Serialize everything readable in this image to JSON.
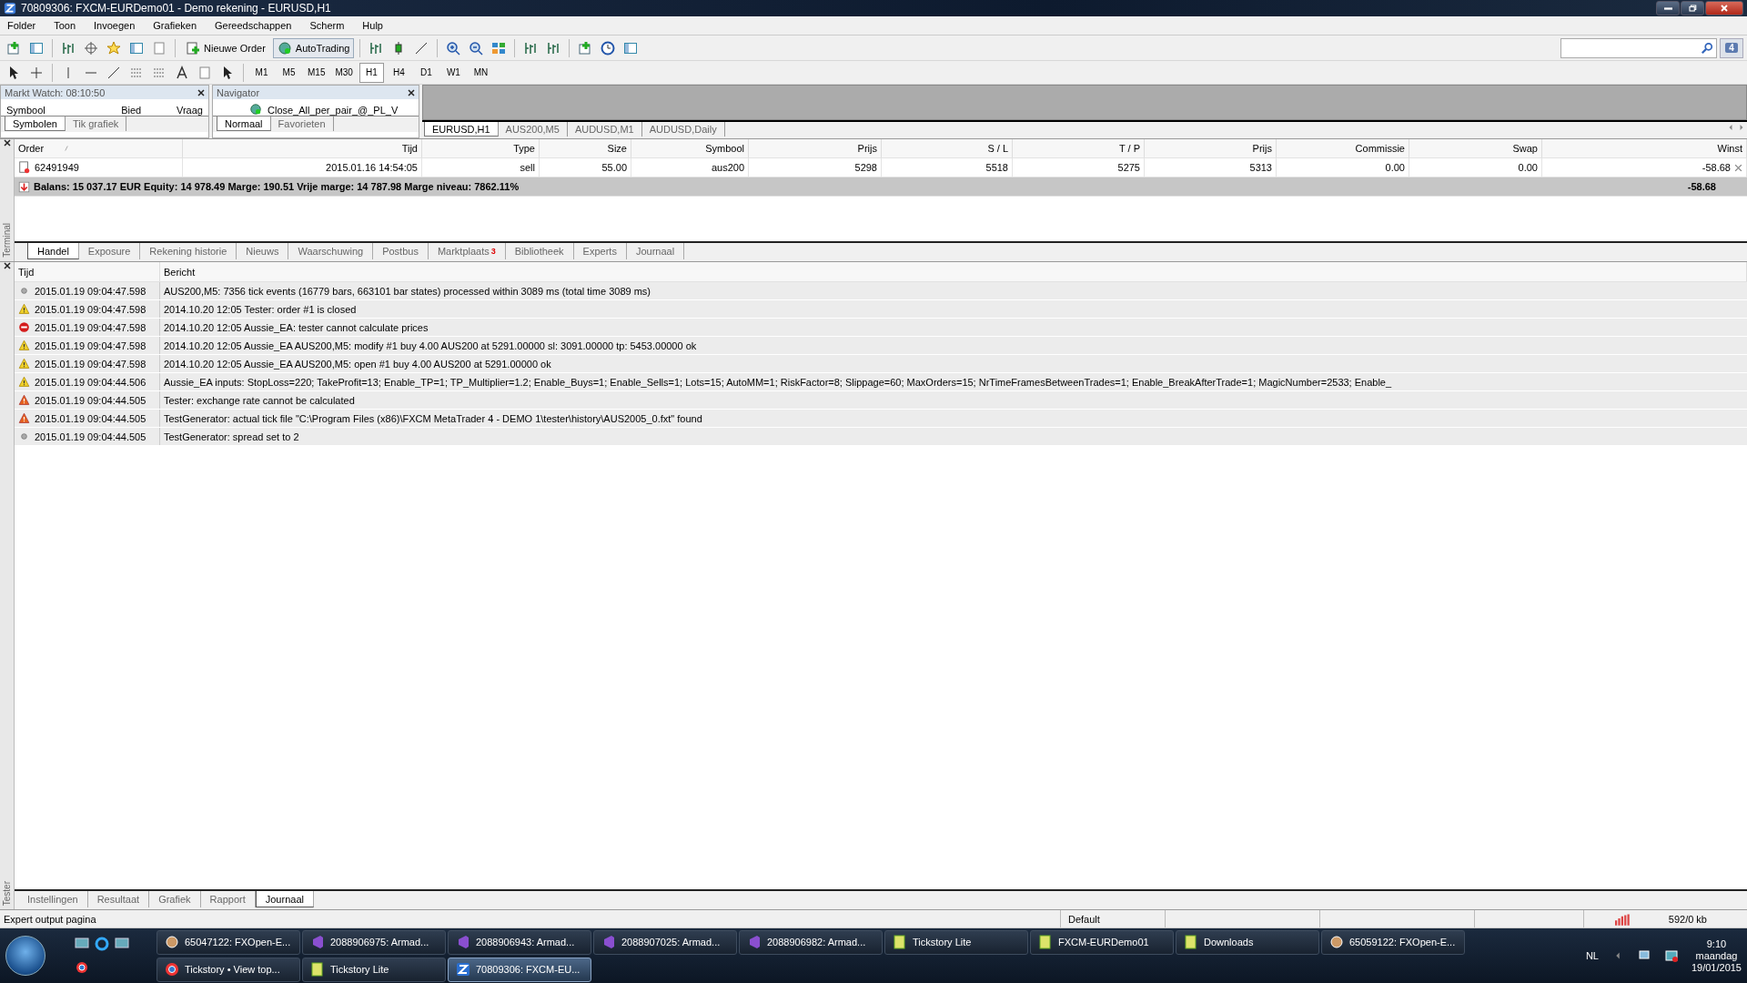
{
  "window": {
    "title": "70809306: FXCM-EURDemo01 - Demo rekening - EURUSD,H1"
  },
  "menu": [
    "Folder",
    "Toon",
    "Invoegen",
    "Grafieken",
    "Gereedschappen",
    "Scherm",
    "Hulp"
  ],
  "toolbar": {
    "buttons": [
      {
        "kind": "order",
        "label": "Nieuwe Order"
      },
      {
        "kind": "autotrading",
        "label": "AutoTrading"
      }
    ],
    "notifications": "4"
  },
  "timeframes": [
    {
      "label": "M1",
      "selected": false
    },
    {
      "label": "M5",
      "selected": false
    },
    {
      "label": "M15",
      "selected": false
    },
    {
      "label": "M30",
      "selected": false
    },
    {
      "label": "H1",
      "selected": true
    },
    {
      "label": "H4",
      "selected": false
    },
    {
      "label": "D1",
      "selected": false
    },
    {
      "label": "W1",
      "selected": false
    },
    {
      "label": "MN",
      "selected": false
    }
  ],
  "market_watch": {
    "title": "Markt Watch: 08:10:50",
    "columns": [
      "Symbool",
      "Bied",
      "Vraag"
    ],
    "tabs": [
      {
        "label": "Symbolen",
        "selected": true
      },
      {
        "label": "Tik grafiek",
        "selected": false
      }
    ]
  },
  "navigator": {
    "title": "Navigator",
    "item": "Close_All_per_pair_@_PL_V",
    "tabs": [
      {
        "label": "Normaal",
        "selected": true
      },
      {
        "label": "Favorieten",
        "selected": false
      }
    ]
  },
  "chart_tabs": [
    {
      "label": "EURUSD,H1",
      "selected": true
    },
    {
      "label": "AUS200,M5",
      "selected": false
    },
    {
      "label": "AUDUSD,M1",
      "selected": false
    },
    {
      "label": "AUDUSD,Daily",
      "selected": false
    }
  ],
  "terminal": {
    "side_label": "Terminal",
    "columns": [
      "Order",
      "Tijd",
      "Type",
      "Size",
      "Symbool",
      "Prijs",
      "S / L",
      "T / P",
      "Prijs",
      "Commissie",
      "Swap",
      "Winst"
    ],
    "rows": [
      [
        "62491949",
        "2015.01.16 14:54:05",
        "sell",
        "55.00",
        "aus200",
        "5298",
        "5518",
        "5275",
        "5313",
        "0.00",
        "0.00",
        "-58.68"
      ]
    ],
    "balance": "Balans: 15 037.17 EUR  Equity: 14 978.49  Marge: 190.51  Vrije marge: 14 787.98  Marge niveau: 7862.11%",
    "balance_profit": "-58.68",
    "tabs": [
      {
        "label": "Handel",
        "selected": true
      },
      {
        "label": "Exposure",
        "selected": false
      },
      {
        "label": "Rekening historie",
        "selected": false
      },
      {
        "label": "Nieuws",
        "selected": false
      },
      {
        "label": "Waarschuwing",
        "selected": false
      },
      {
        "label": "Postbus",
        "selected": false
      },
      {
        "label": "Marktplaats",
        "badge": "3",
        "selected": false
      },
      {
        "label": "Bibliotheek",
        "selected": false
      },
      {
        "label": "Experts",
        "selected": false
      },
      {
        "label": "Journaal",
        "selected": false
      }
    ]
  },
  "tester": {
    "side_label": "Tester",
    "columns": [
      "Tijd",
      "Bericht"
    ],
    "rows": [
      {
        "kind": "info",
        "time": "2015.01.19 09:04:47.598",
        "message": "AUS200,M5: 7356 tick events (16779 bars, 663101 bar states) processed within 3089 ms (total time 3089 ms)"
      },
      {
        "kind": "warning",
        "time": "2015.01.19 09:04:47.598",
        "message": "2014.10.20 12:05  Tester: order #1 is closed"
      },
      {
        "kind": "error",
        "time": "2015.01.19 09:04:47.598",
        "message": "2014.10.20 12:05  Aussie_EA: tester cannot calculate prices"
      },
      {
        "kind": "warning",
        "time": "2015.01.19 09:04:47.598",
        "message": "2014.10.20 12:05  Aussie_EA AUS200,M5: modify #1 buy 4.00 AUS200 at 5291.00000 sl: 3091.00000 tp: 5453.00000 ok"
      },
      {
        "kind": "warning",
        "time": "2015.01.19 09:04:47.598",
        "message": "2014.10.20 12:05  Aussie_EA AUS200,M5: open #1 buy 4.00 AUS200 at 5291.00000 ok"
      },
      {
        "kind": "warning",
        "time": "2015.01.19 09:04:44.506",
        "message": "Aussie_EA inputs: StopLoss=220; TakeProfit=13; Enable_TP=1; TP_Multiplier=1.2; Enable_Buys=1; Enable_Sells=1; Lots=15; AutoMM=1; RiskFactor=8; Slippage=60; MaxOrders=15; NrTimeFramesBetweenTrades=1; Enable_BreakAfterTrade=1; MagicNumber=2533; Enable_"
      },
      {
        "kind": "alert",
        "time": "2015.01.19 09:04:44.505",
        "message": "Tester: exchange rate cannot be calculated"
      },
      {
        "kind": "alert",
        "time": "2015.01.19 09:04:44.505",
        "message": "TestGenerator: actual tick file \"C:\\Program Files (x86)\\FXCM MetaTrader 4 - DEMO 1\\tester\\history\\AUS2005_0.fxt\" found"
      },
      {
        "kind": "info",
        "time": "2015.01.19 09:04:44.505",
        "message": "TestGenerator: spread set to 2"
      }
    ],
    "tabs": [
      {
        "label": "Instellingen",
        "selected": false
      },
      {
        "label": "Resultaat",
        "selected": false
      },
      {
        "label": "Grafiek",
        "selected": false
      },
      {
        "label": "Rapport",
        "selected": false
      },
      {
        "label": "Journaal",
        "selected": true
      }
    ]
  },
  "status_bar": {
    "left": "Expert output pagina",
    "profile": "Default",
    "traffic": "592/0 kb"
  },
  "taskbar": {
    "buttons": [
      {
        "kind": "fx",
        "label": "65047122: FXOpen-E...",
        "selected": false
      },
      {
        "kind": "vs",
        "label": "2088906975: Armad...",
        "selected": false
      },
      {
        "kind": "vs",
        "label": "2088906943: Armad...",
        "selected": false
      },
      {
        "kind": "vs",
        "label": "2088907025: Armad...",
        "selected": false
      },
      {
        "kind": "vs",
        "label": "2088906982: Armad...",
        "selected": false
      },
      {
        "kind": "app",
        "label": "Tickstory Lite",
        "selected": false
      },
      {
        "kind": "app",
        "label": "FXCM-EURDemo01",
        "selected": false
      },
      {
        "kind": "app",
        "label": "Downloads",
        "selected": false
      },
      {
        "kind": "fx",
        "label": "65059122: FXOpen-E...",
        "selected": false
      },
      {
        "kind": "browser",
        "label": "Tickstory • View top...",
        "selected": false
      },
      {
        "kind": "app",
        "label": "Tickstory Lite",
        "selected": false
      },
      {
        "kind": "mt",
        "label": "70809306: FXCM-EU...",
        "selected": true
      }
    ],
    "language": "NL",
    "time": "9:10",
    "day": "maandag",
    "date": "19/01/2015"
  }
}
